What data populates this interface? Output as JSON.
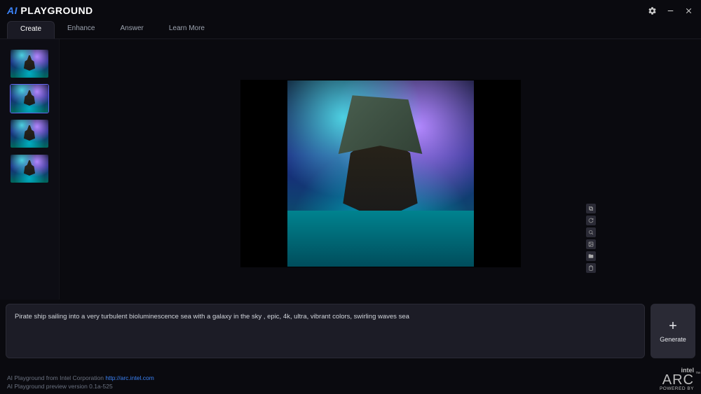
{
  "app": {
    "title_prefix": "AI",
    "title_main": "PLAYGROUND"
  },
  "tabs": [
    {
      "label": "Create",
      "active": true
    },
    {
      "label": "Enhance",
      "active": false
    },
    {
      "label": "Answer",
      "active": false
    },
    {
      "label": "Learn More",
      "active": false
    }
  ],
  "thumbnails": [
    {
      "selected": false
    },
    {
      "selected": true
    },
    {
      "selected": false
    },
    {
      "selected": false
    }
  ],
  "action_icons": [
    "copy-icon",
    "refresh-icon",
    "zoom-icon",
    "image-icon",
    "folder-icon",
    "delete-icon"
  ],
  "prompt": {
    "value": "Pirate ship sailing into a very turbulent bioluminescence sea with a galaxy in the sky , epic, 4k, ultra, vibrant colors, swirling waves sea"
  },
  "generate": {
    "label": "Generate",
    "plus": "+"
  },
  "footer": {
    "attribution_prefix": "AI Playground from Intel Corporation ",
    "link_text": "http://arc.intel.com",
    "version": "AI Playground preview version 0.1a-525"
  },
  "brand": {
    "intel": "intel",
    "arc": "ARC",
    "powered": "POWERED BY"
  }
}
